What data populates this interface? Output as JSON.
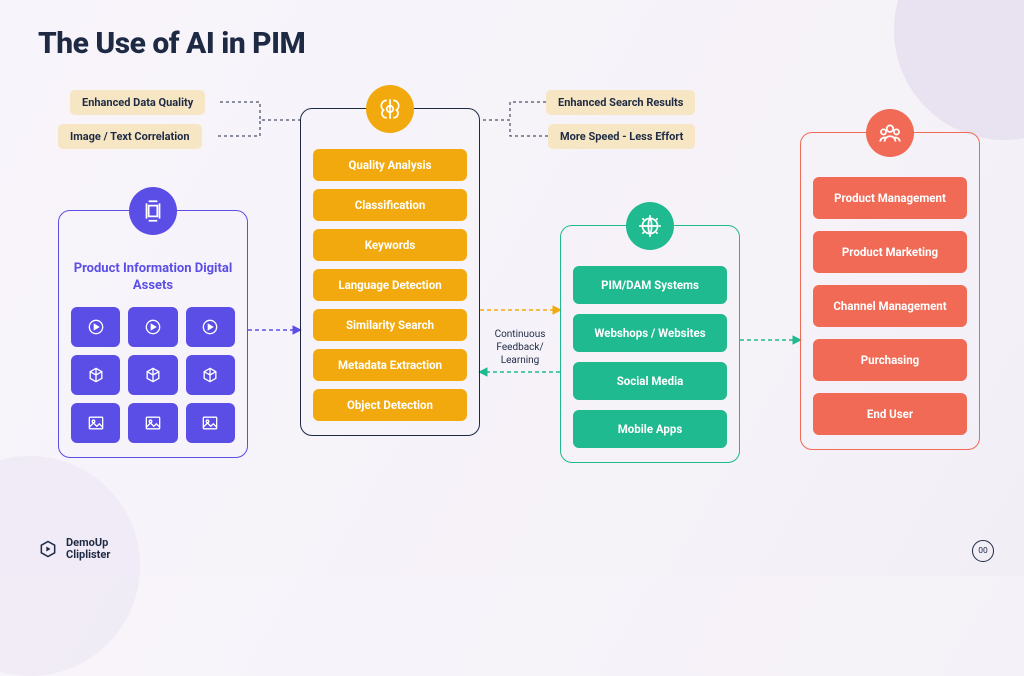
{
  "title": "The Use of AI in PIM",
  "col1": {
    "title": "Product Information Digital Assets"
  },
  "col2": {
    "items": [
      "Quality Analysis",
      "Classification",
      "Keywords",
      "Language Detection",
      "Similarity Search",
      "Metadata Extraction",
      "Object Detection"
    ]
  },
  "col3": {
    "items": [
      "PIM/DAM Systems",
      "Webshops / Websites",
      "Social Media",
      "Mobile Apps"
    ]
  },
  "col4": {
    "items": [
      "Product Management",
      "Product Marketing",
      "Channel Management",
      "Purchasing",
      "End User"
    ]
  },
  "callouts": {
    "left_top": "Enhanced Data Quality",
    "left_bottom": "Image / Text Correlation",
    "right_top": "Enhanced Search Results",
    "right_bottom": "More Speed - Less Effort"
  },
  "feedback": "Continuous Feedback/ Learning",
  "footer": {
    "brand1": "DemoUp",
    "brand2": "Cliplister"
  },
  "page": "00"
}
